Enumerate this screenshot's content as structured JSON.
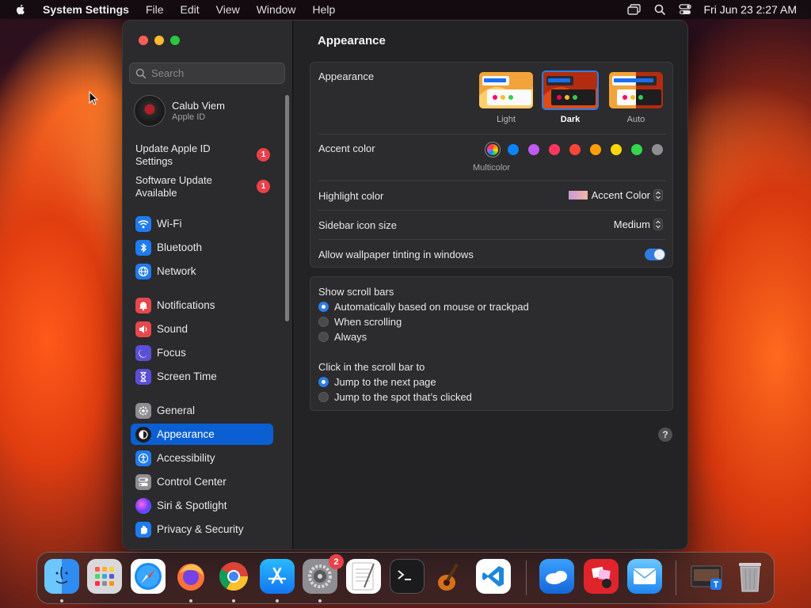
{
  "menubar": {
    "app_name": "System Settings",
    "items": [
      "File",
      "Edit",
      "View",
      "Window",
      "Help"
    ],
    "clock": "Fri Jun 23  2:27 AM"
  },
  "sidebar": {
    "search_placeholder": "Search",
    "profile": {
      "name": "Calub Viem",
      "subtitle": "Apple ID"
    },
    "notices": [
      {
        "label_line1": "Update Apple ID",
        "label_line2": "Settings",
        "badge": "1"
      },
      {
        "label_line1": "Software Update",
        "label_line2": "Available",
        "badge": "1"
      }
    ],
    "items": [
      {
        "label": "Wi-Fi",
        "icon": "wifi-icon",
        "color": "#1e7cf0"
      },
      {
        "label": "Bluetooth",
        "icon": "bluetooth-icon",
        "color": "#1e7cf0"
      },
      {
        "label": "Network",
        "icon": "globe-icon",
        "color": "#1e7cf0"
      },
      {
        "label": "Notifications",
        "icon": "bell-icon",
        "color": "#e5484d"
      },
      {
        "label": "Sound",
        "icon": "speaker-icon",
        "color": "#e5484d"
      },
      {
        "label": "Focus",
        "icon": "moon-icon",
        "color": "#5b4fd8"
      },
      {
        "label": "Screen Time",
        "icon": "hourglass-icon",
        "color": "#5b4fd8"
      },
      {
        "label": "General",
        "icon": "gear-icon",
        "color": "#8e8e93"
      },
      {
        "label": "Appearance",
        "icon": "appearance-icon",
        "color": "#1c1c1e"
      },
      {
        "label": "Accessibility",
        "icon": "accessibility-icon",
        "color": "#1e7cf0"
      },
      {
        "label": "Control Center",
        "icon": "control-center-icon",
        "color": "#8e8e93"
      },
      {
        "label": "Siri & Spotlight",
        "icon": "siri-icon",
        "color": "#c03ad0"
      },
      {
        "label": "Privacy & Security",
        "icon": "hand-icon",
        "color": "#1e7cf0"
      }
    ],
    "active": "Appearance"
  },
  "main": {
    "title": "Appearance",
    "appearance": {
      "label": "Appearance",
      "options": [
        "Light",
        "Dark",
        "Auto"
      ],
      "selected": "Dark"
    },
    "accent": {
      "label": "Accent color",
      "multicolor_label": "Multicolor",
      "colors": [
        "#0a84ff",
        "#bf5af2",
        "#ff375f",
        "#ff453a",
        "#ff9f0a",
        "#ffd60a",
        "#32d74b",
        "#8e8e93"
      ]
    },
    "highlight": {
      "label": "Highlight color",
      "value": "Accent Color"
    },
    "sidebar_icon": {
      "label": "Sidebar icon size",
      "value": "Medium"
    },
    "tinting": {
      "label": "Allow wallpaper tinting in windows",
      "on": true
    },
    "scroll": {
      "title": "Show scroll bars",
      "options": [
        "Automatically based on mouse or trackpad",
        "When scrolling",
        "Always"
      ],
      "selected": 0
    },
    "click": {
      "title": "Click in the scroll bar to",
      "options": [
        "Jump to the next page",
        "Jump to the spot that’s clicked"
      ],
      "selected": 0
    },
    "help": "?"
  },
  "dock": {
    "apps": [
      {
        "name": "Finder",
        "icon": "finder-icon",
        "running": true
      },
      {
        "name": "Launchpad",
        "icon": "launchpad-icon",
        "running": false
      },
      {
        "name": "Safari",
        "icon": "safari-icon",
        "running": false
      },
      {
        "name": "Firefox",
        "icon": "firefox-icon",
        "running": true
      },
      {
        "name": "Chrome",
        "icon": "chrome-icon",
        "running": true
      },
      {
        "name": "App Store",
        "icon": "app-store-icon",
        "running": true
      },
      {
        "name": "System Settings",
        "icon": "system-settings-icon",
        "running": true,
        "badge": "2"
      },
      {
        "name": "TextEdit",
        "icon": "textedit-icon",
        "running": false
      },
      {
        "name": "Terminal",
        "icon": "terminal-icon",
        "running": false
      },
      {
        "name": "GarageBand",
        "icon": "garageband-icon",
        "running": false
      },
      {
        "name": "VS Code",
        "icon": "vscode-icon",
        "running": false
      },
      {
        "name": "Weather",
        "icon": "weather-icon",
        "running": false
      },
      {
        "name": "Photo Booth",
        "icon": "photo-booth-icon",
        "running": false
      },
      {
        "name": "Mail",
        "icon": "mail-icon",
        "running": false
      },
      {
        "name": "Downloads",
        "icon": "downloads-stack-icon",
        "running": false
      },
      {
        "name": "Trash",
        "icon": "trash-icon",
        "running": false
      }
    ]
  }
}
